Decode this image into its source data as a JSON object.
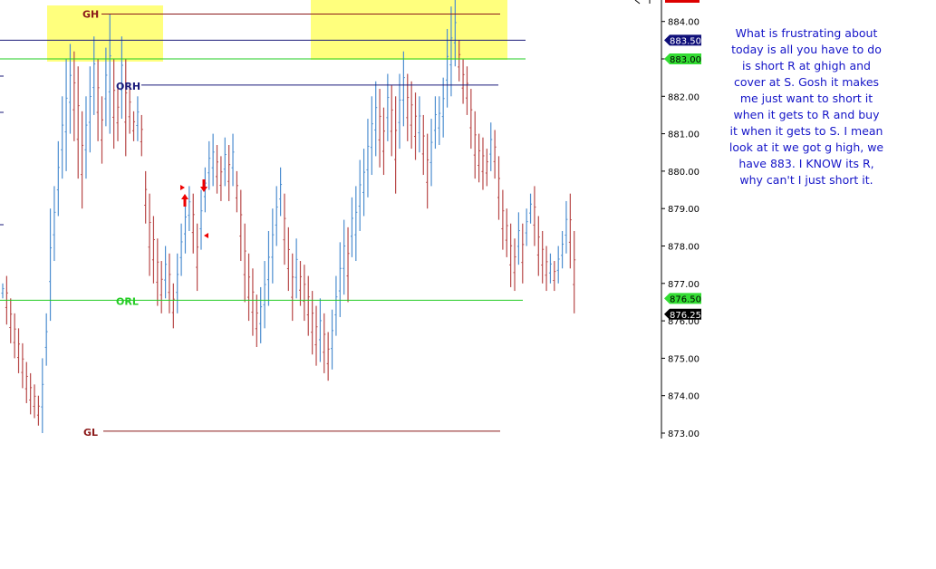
{
  "chart_data": {
    "type": "bar",
    "subtype": "ohlc-price-bars",
    "title": "",
    "xlabel": "",
    "ylabel": "",
    "ylim": [
      873.0,
      884.4
    ],
    "y_ticks": [
      "884.00",
      "883.00",
      "882.00",
      "881.00",
      "880.00",
      "879.00",
      "878.00",
      "877.00",
      "876.00",
      "875.00",
      "874.00",
      "873.00"
    ],
    "up_color": "#4d8ed0",
    "down_color": "#b84848",
    "bars": [
      [
        877.0,
        876.6
      ],
      [
        877.2,
        875.9
      ],
      [
        876.6,
        875.4
      ],
      [
        876.2,
        875.0
      ],
      [
        875.8,
        874.6
      ],
      [
        875.4,
        874.2
      ],
      [
        874.9,
        873.8
      ],
      [
        874.6,
        873.5
      ],
      [
        874.3,
        873.4
      ],
      [
        874.0,
        873.2
      ],
      [
        875.0,
        873.0
      ],
      [
        876.2,
        874.8
      ],
      [
        879.0,
        876.0
      ],
      [
        879.6,
        877.6
      ],
      [
        880.8,
        878.8
      ],
      [
        882.0,
        879.8
      ],
      [
        883.0,
        880.0
      ],
      [
        883.4,
        881.0
      ],
      [
        883.2,
        880.8
      ],
      [
        882.8,
        879.8
      ],
      [
        881.6,
        879.0
      ],
      [
        882.0,
        879.8
      ],
      [
        882.8,
        880.5
      ],
      [
        883.6,
        881.5
      ],
      [
        883.0,
        880.8
      ],
      [
        882.0,
        880.2
      ],
      [
        883.3,
        881.2
      ],
      [
        884.2,
        881.0
      ],
      [
        883.0,
        880.6
      ],
      [
        882.2,
        880.8
      ],
      [
        883.6,
        881.4
      ],
      [
        883.0,
        880.4
      ],
      [
        882.3,
        881.0
      ],
      [
        881.6,
        880.8
      ],
      [
        882.0,
        880.8
      ],
      [
        881.5,
        880.4
      ],
      [
        880.0,
        878.6
      ],
      [
        879.4,
        877.2
      ],
      [
        878.8,
        877.0
      ],
      [
        878.2,
        876.4
      ],
      [
        877.6,
        876.2
      ],
      [
        878.0,
        876.6
      ],
      [
        877.8,
        876.2
      ],
      [
        877.0,
        875.8
      ],
      [
        877.8,
        876.2
      ],
      [
        878.6,
        877.2
      ],
      [
        879.3,
        877.8
      ],
      [
        879.6,
        878.4
      ],
      [
        879.4,
        877.8
      ],
      [
        878.6,
        876.8
      ],
      [
        879.5,
        877.9
      ],
      [
        880.1,
        878.9
      ],
      [
        880.8,
        879.5
      ],
      [
        881.0,
        879.6
      ],
      [
        880.7,
        879.4
      ],
      [
        880.4,
        879.2
      ],
      [
        880.9,
        879.6
      ],
      [
        880.7,
        879.2
      ],
      [
        881.0,
        879.6
      ],
      [
        880.0,
        878.9
      ],
      [
        879.5,
        877.6
      ],
      [
        878.6,
        876.5
      ],
      [
        877.8,
        876.0
      ],
      [
        877.4,
        875.6
      ],
      [
        876.7,
        875.3
      ],
      [
        876.9,
        875.4
      ],
      [
        877.6,
        875.8
      ],
      [
        878.4,
        876.4
      ],
      [
        879.0,
        877.0
      ],
      [
        879.6,
        878.0
      ],
      [
        880.1,
        878.8
      ],
      [
        879.4,
        877.5
      ],
      [
        878.5,
        876.8
      ],
      [
        877.8,
        876.0
      ],
      [
        878.2,
        876.6
      ],
      [
        877.6,
        876.4
      ],
      [
        877.5,
        876.0
      ],
      [
        877.2,
        875.6
      ],
      [
        876.8,
        875.1
      ],
      [
        876.4,
        874.8
      ],
      [
        876.6,
        874.9
      ],
      [
        876.2,
        874.6
      ],
      [
        875.7,
        874.4
      ],
      [
        876.3,
        874.7
      ],
      [
        877.2,
        875.6
      ],
      [
        878.1,
        876.1
      ],
      [
        878.7,
        876.7
      ],
      [
        878.5,
        876.5
      ],
      [
        879.3,
        877.7
      ],
      [
        879.6,
        877.6
      ],
      [
        880.3,
        878.4
      ],
      [
        880.6,
        878.8
      ],
      [
        881.4,
        879.3
      ],
      [
        882.0,
        879.9
      ],
      [
        882.4,
        880.4
      ],
      [
        882.2,
        880.1
      ],
      [
        881.7,
        879.9
      ],
      [
        882.6,
        880.8
      ],
      [
        882.3,
        880.4
      ],
      [
        882.0,
        879.4
      ],
      [
        882.6,
        880.6
      ],
      [
        883.2,
        881.2
      ],
      [
        882.6,
        880.8
      ],
      [
        882.4,
        880.6
      ],
      [
        882.1,
        880.3
      ],
      [
        882.0,
        880.5
      ],
      [
        881.5,
        879.9
      ],
      [
        881.0,
        879.0
      ],
      [
        881.4,
        879.6
      ],
      [
        882.0,
        880.6
      ],
      [
        882.0,
        880.7
      ],
      [
        882.5,
        880.9
      ],
      [
        883.8,
        881.7
      ],
      [
        884.4,
        882.0
      ],
      [
        884.6,
        882.8
      ],
      [
        883.5,
        882.4
      ],
      [
        883.0,
        881.8
      ],
      [
        882.8,
        881.5
      ],
      [
        882.2,
        880.6
      ],
      [
        881.6,
        879.8
      ],
      [
        881.0,
        879.7
      ],
      [
        880.9,
        879.5
      ],
      [
        880.6,
        879.6
      ],
      [
        881.3,
        880.0
      ],
      [
        881.1,
        879.8
      ],
      [
        880.4,
        878.7
      ],
      [
        879.5,
        877.9
      ],
      [
        879.0,
        877.7
      ],
      [
        878.6,
        876.9
      ],
      [
        878.2,
        876.8
      ],
      [
        878.9,
        877.5
      ],
      [
        878.6,
        877.0
      ],
      [
        879.0,
        878.0
      ],
      [
        879.4,
        878.6
      ],
      [
        879.6,
        878.0
      ],
      [
        878.8,
        877.2
      ],
      [
        878.4,
        877.0
      ],
      [
        878.0,
        876.8
      ],
      [
        877.8,
        877.0
      ],
      [
        877.6,
        876.8
      ],
      [
        878.0,
        877.0
      ],
      [
        878.4,
        877.4
      ],
      [
        879.2,
        877.8
      ],
      [
        879.4,
        877.4
      ],
      [
        878.4,
        876.2
      ]
    ],
    "levels": [
      {
        "label": "GH",
        "price": 884.2,
        "color": "#8b1a1a"
      },
      {
        "label": "ORH",
        "price": 882.3,
        "color": "#1a1a7a"
      },
      {
        "label": "",
        "price": 883.5,
        "color": "#1a1a7a"
      },
      {
        "label": "",
        "price": 883.0,
        "color": "#22cc22"
      },
      {
        "label": "ORL",
        "price": 876.55,
        "color": "#22cc22"
      },
      {
        "label": "GL",
        "price": 873.05,
        "color": "#8b1a1a"
      }
    ],
    "price_tags": [
      {
        "text": "883.50",
        "price": 883.5,
        "bg": "#10107a",
        "fg": "#ffffff"
      },
      {
        "text": "883.00",
        "price": 883.0,
        "bg": "#33dd33",
        "fg": "#000000"
      },
      {
        "text": "876.50",
        "price": 876.55,
        "bg": "#33dd33",
        "fg": "#000000"
      },
      {
        "text": "876.25",
        "price": 876.25,
        "bg": "#000000",
        "fg": "#ffffff"
      }
    ],
    "highlight_color": "#ffff66"
  },
  "annotation": {
    "lines": [
      "What is frustrating about",
      "today is all you have to do",
      "is short R at ghigh and",
      "cover at S. Gosh it makes",
      "me just want to short it",
      "when it gets to R and buy",
      "it when it gets to S. I mean",
      "look at it we got g high, we",
      "have 883. I KNOW its R,",
      "why can't I just short it."
    ],
    "color": "#1515c8"
  }
}
